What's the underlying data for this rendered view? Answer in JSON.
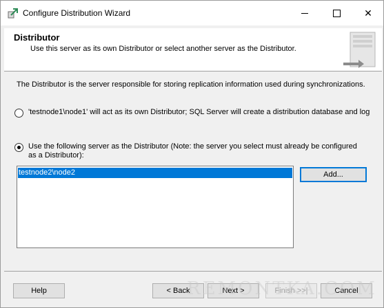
{
  "window": {
    "title": "Configure Distribution Wizard",
    "icon": "wizard-icon"
  },
  "header": {
    "title": "Distributor",
    "subtitle": "Use this server as its own Distributor or select another server as the Distributor.",
    "art_icon": "server-icon"
  },
  "body": {
    "intro": "The Distributor is the server responsible for storing replication information used during synchronizations.",
    "options": [
      {
        "label": "'testnode1\\node1' will act as its own Distributor; SQL Server will create a distribution database and log",
        "checked": false
      },
      {
        "label": "Use the following server as the Distributor (Note: the server you select must already be configured as a Distributor):",
        "checked": true
      }
    ],
    "servers": [
      "testnode2\\node2"
    ],
    "add_button": "Add..."
  },
  "footer": {
    "help": "Help",
    "back": "< Back",
    "next": "Next >",
    "finish": "Finish >>|",
    "cancel": "Cancel"
  },
  "watermark": "REMONTKA.COM",
  "colors": {
    "selection": "#0078d7",
    "dialog_bg": "#f0f0f0"
  }
}
